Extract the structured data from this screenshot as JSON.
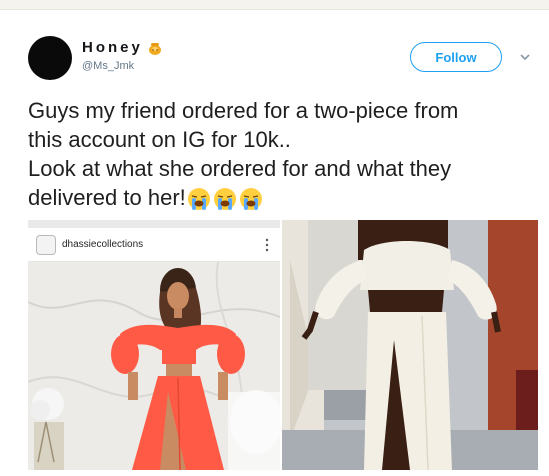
{
  "tweet": {
    "display_name": "Honey",
    "handle": "@Ms_Jmk",
    "follow_label": "Follow",
    "text_lines": [
      "Guys my friend ordered for a two-piece from",
      "this account on IG for 10k..",
      "Look at what she ordered for and what they",
      "delivered to her!"
    ],
    "emojis": [
      "crying-face-emoji",
      "crying-face-emoji",
      "crying-face-emoji"
    ]
  },
  "media": {
    "left_post": {
      "username": "dhassiecollections"
    }
  },
  "colors": {
    "accent": "#1da1f2",
    "handle": "#657786",
    "text": "#1f1f1f",
    "outfit_ordered": "#ff5a45",
    "outfit_delivered": "#f2efe6"
  }
}
